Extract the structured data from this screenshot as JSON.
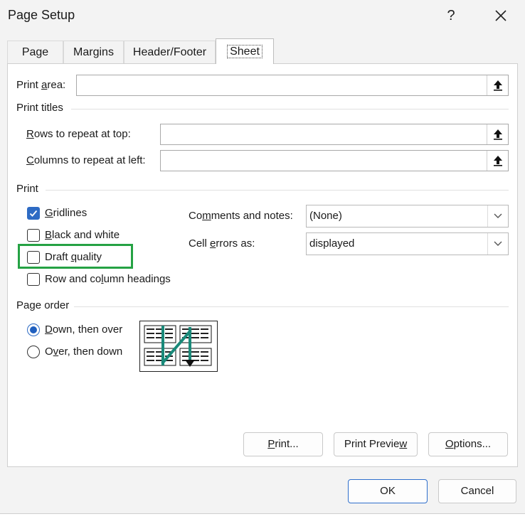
{
  "dialog": {
    "title": "Page Setup",
    "help_label": "?"
  },
  "tabs": [
    {
      "label": "Page"
    },
    {
      "label": "Margins"
    },
    {
      "label": "Header/Footer"
    },
    {
      "label": "Sheet",
      "active": true
    }
  ],
  "print_area": {
    "label_pre": "Print ",
    "label_key": "a",
    "label_post": "rea:",
    "value": ""
  },
  "print_titles": {
    "heading": "Print titles",
    "rows": {
      "label_key": "R",
      "label_post": "ows to repeat at top:",
      "value": ""
    },
    "columns": {
      "label_key": "C",
      "label_post": "olumns to repeat at left:",
      "value": ""
    }
  },
  "print": {
    "heading": "Print",
    "gridlines": {
      "label_key": "G",
      "label_post": "ridlines",
      "checked": true
    },
    "black_white": {
      "label_key": "B",
      "label_post": "lack and white",
      "checked": false
    },
    "draft": {
      "label_pre": "Draft ",
      "label_key": "q",
      "label_post": "uality",
      "checked": false
    },
    "headings": {
      "label_pre": "Row and co",
      "label_key": "l",
      "label_post": "umn headings",
      "checked": false
    },
    "comments": {
      "label_pre": "Co",
      "label_key": "m",
      "label_post": "ments and notes:",
      "value": "(None)"
    },
    "cell_errors": {
      "label_pre": "Cell ",
      "label_key": "e",
      "label_post": "rrors as:",
      "value": "displayed"
    }
  },
  "page_order": {
    "heading": "Page order",
    "down_over": {
      "label_key": "D",
      "label_post": "own, then over",
      "selected": true
    },
    "over_down": {
      "label_pre": "O",
      "label_key": "v",
      "label_post": "er, then down",
      "selected": false
    }
  },
  "buttons": {
    "print": {
      "label_key": "P",
      "label_post": "rint..."
    },
    "preview": {
      "label_pre": "Print Previe",
      "label_key": "w",
      "label_post": ""
    },
    "options": {
      "label_key": "O",
      "label_post": "ptions..."
    },
    "ok": "OK",
    "cancel": "Cancel"
  },
  "colors": {
    "accent": "#1f5fbf",
    "highlight": "#25a244",
    "arrow": "#1a8a7a"
  }
}
